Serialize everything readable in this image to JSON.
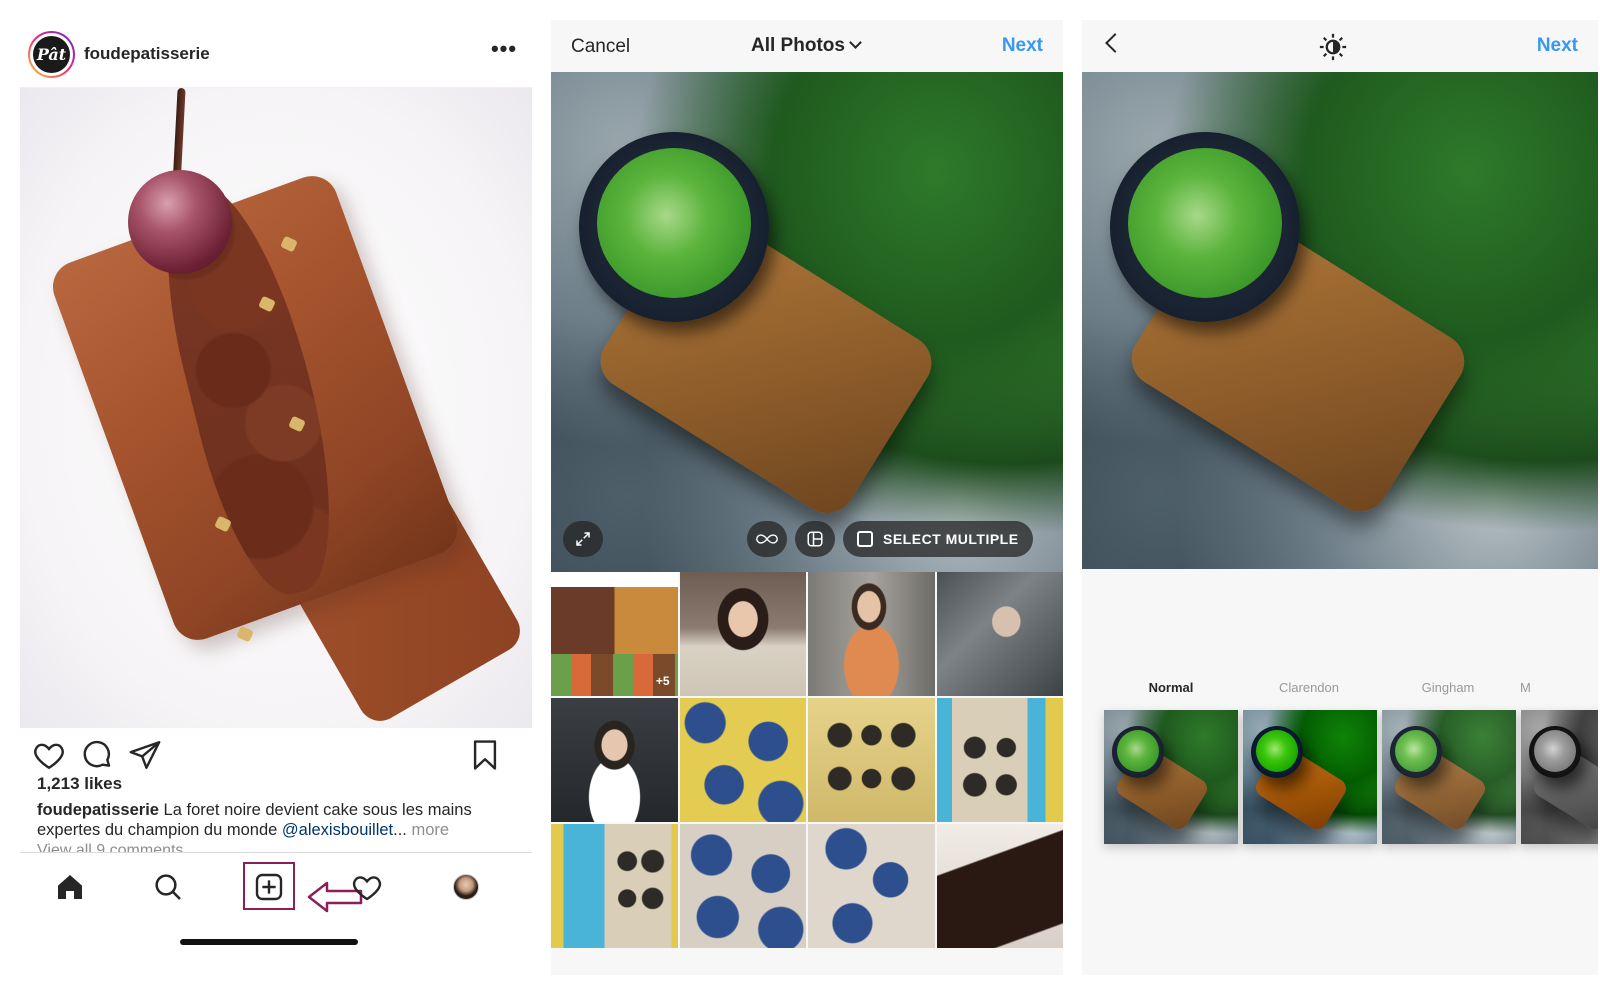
{
  "feed": {
    "username": "foudepatisserie",
    "logo_text": "Pât",
    "more_label": "•••",
    "likes": "1,213 likes",
    "caption_user": "foudepatisserie",
    "caption_text": " La foret noire devient cake sous les mains expertes du champion du monde ",
    "caption_mention": "@alexisbouillet",
    "caption_ellipsis": "...",
    "caption_more": " more",
    "comments_link": "View all 9 comments",
    "tabs": [
      "home-icon",
      "search-icon",
      "new-post-icon",
      "heart-icon",
      "profile-avatar"
    ],
    "highlight_color": "#8a1f5a"
  },
  "gallery": {
    "cancel": "Cancel",
    "album": "All Photos",
    "next": "Next",
    "select_multiple": "SELECT MULTIPLE",
    "grid_badge": "+5",
    "accent": "#3897f0"
  },
  "editor": {
    "next": "Next",
    "filters": [
      "Normal",
      "Clarendon",
      "Gingham",
      "M"
    ],
    "active_filter": "Normal"
  }
}
